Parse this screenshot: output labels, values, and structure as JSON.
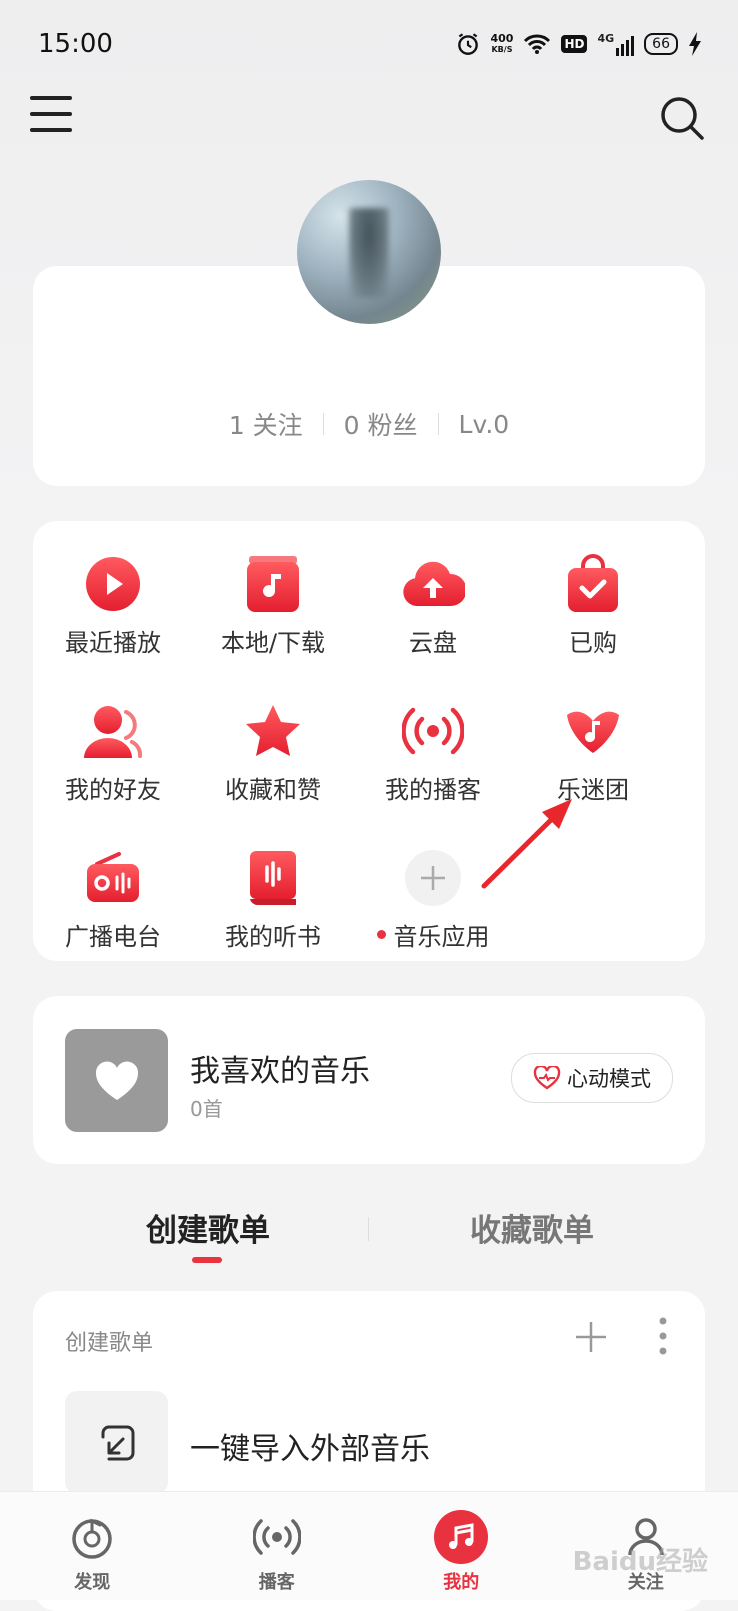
{
  "status_bar": {
    "time": "15:00",
    "speed_top": "400",
    "speed_bottom": "KB/S",
    "hd": "HD",
    "network": "4G",
    "battery": "66"
  },
  "profile": {
    "follow": "1 关注",
    "fans": "0 粉丝",
    "level": "Lv.0"
  },
  "grid_items": [
    {
      "label": "最近播放",
      "icon": "play-circle-icon"
    },
    {
      "label": "本地/下载",
      "icon": "music-file-icon"
    },
    {
      "label": "云盘",
      "icon": "cloud-upload-icon"
    },
    {
      "label": "已购",
      "icon": "shopping-bag-icon"
    },
    {
      "label": "我的好友",
      "icon": "friends-icon"
    },
    {
      "label": "收藏和赞",
      "icon": "star-icon"
    },
    {
      "label": "我的播客",
      "icon": "podcast-icon"
    },
    {
      "label": "乐迷团",
      "icon": "heart-music-icon"
    },
    {
      "label": "广播电台",
      "icon": "radio-icon"
    },
    {
      "label": "我的听书",
      "icon": "audiobook-icon"
    },
    {
      "label": "音乐应用",
      "icon": "add-icon"
    }
  ],
  "favorites": {
    "title": "我喜欢的音乐",
    "count": "0首",
    "mode_button": "心动模式"
  },
  "tabs": {
    "active": "创建歌单",
    "inactive": "收藏歌单"
  },
  "playlist_section": {
    "header": "创建歌单",
    "import_label": "一键导入外部音乐"
  },
  "bottom_nav": [
    {
      "label": "发现",
      "icon": "netease-logo-icon"
    },
    {
      "label": "播客",
      "icon": "podcast-nav-icon"
    },
    {
      "label": "我的",
      "icon": "music-note-icon"
    },
    {
      "label": "关注",
      "icon": "follow-icon"
    }
  ],
  "colors": {
    "accent": "#e8323f",
    "card": "#ffffff",
    "background": "#f3f3f4"
  },
  "watermark": "Baidu经验"
}
